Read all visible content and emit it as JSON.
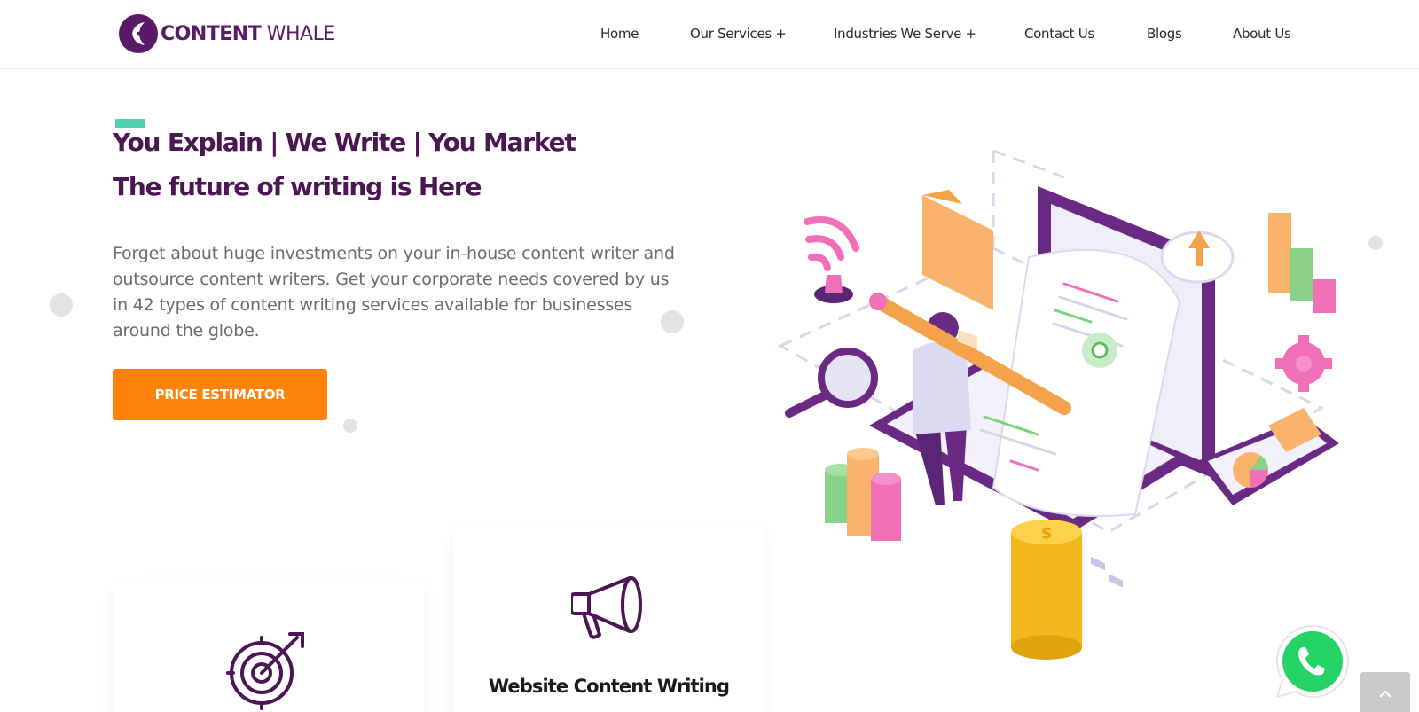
{
  "brand": {
    "name_bold": "CONTENT",
    "name_light": "WHALE",
    "color": "#5a1a67"
  },
  "nav": {
    "items": [
      {
        "label": "Home"
      },
      {
        "label": "Our Services +"
      },
      {
        "label": "Industries We Serve +"
      },
      {
        "label": "Contact Us"
      },
      {
        "label": "Blogs"
      },
      {
        "label": "About Us"
      }
    ]
  },
  "hero": {
    "headline_1": "You Explain | We Write | You Market",
    "headline_2": "The future of writing is Here",
    "paragraph": "Forget about huge investments on your in-house content writer and outsource content writers. Get your corporate needs covered by us in 42 types of content writing services available for businesses around the globe.",
    "cta_label": "PRICE ESTIMATOR",
    "accent_color": "#4fd1b0",
    "cta_color": "#ff8308",
    "headline_color": "#4c1554"
  },
  "cards": [
    {
      "icon": "target-icon",
      "title": ""
    },
    {
      "icon": "megaphone-icon",
      "title": "Website Content Writing"
    }
  ],
  "illustration": {
    "icons": [
      "laptop-icon",
      "person-with-pencil-icon",
      "folder-icon",
      "wifi-icon",
      "magnifier-icon",
      "coin-stack-icon",
      "bar-chart-icon",
      "gear-icon",
      "pie-chart-icon",
      "cloud-upload-icon"
    ]
  },
  "widgets": {
    "whatsapp_icon": "whatsapp-icon",
    "scroll_top_icon": "chevron-up-icon"
  }
}
